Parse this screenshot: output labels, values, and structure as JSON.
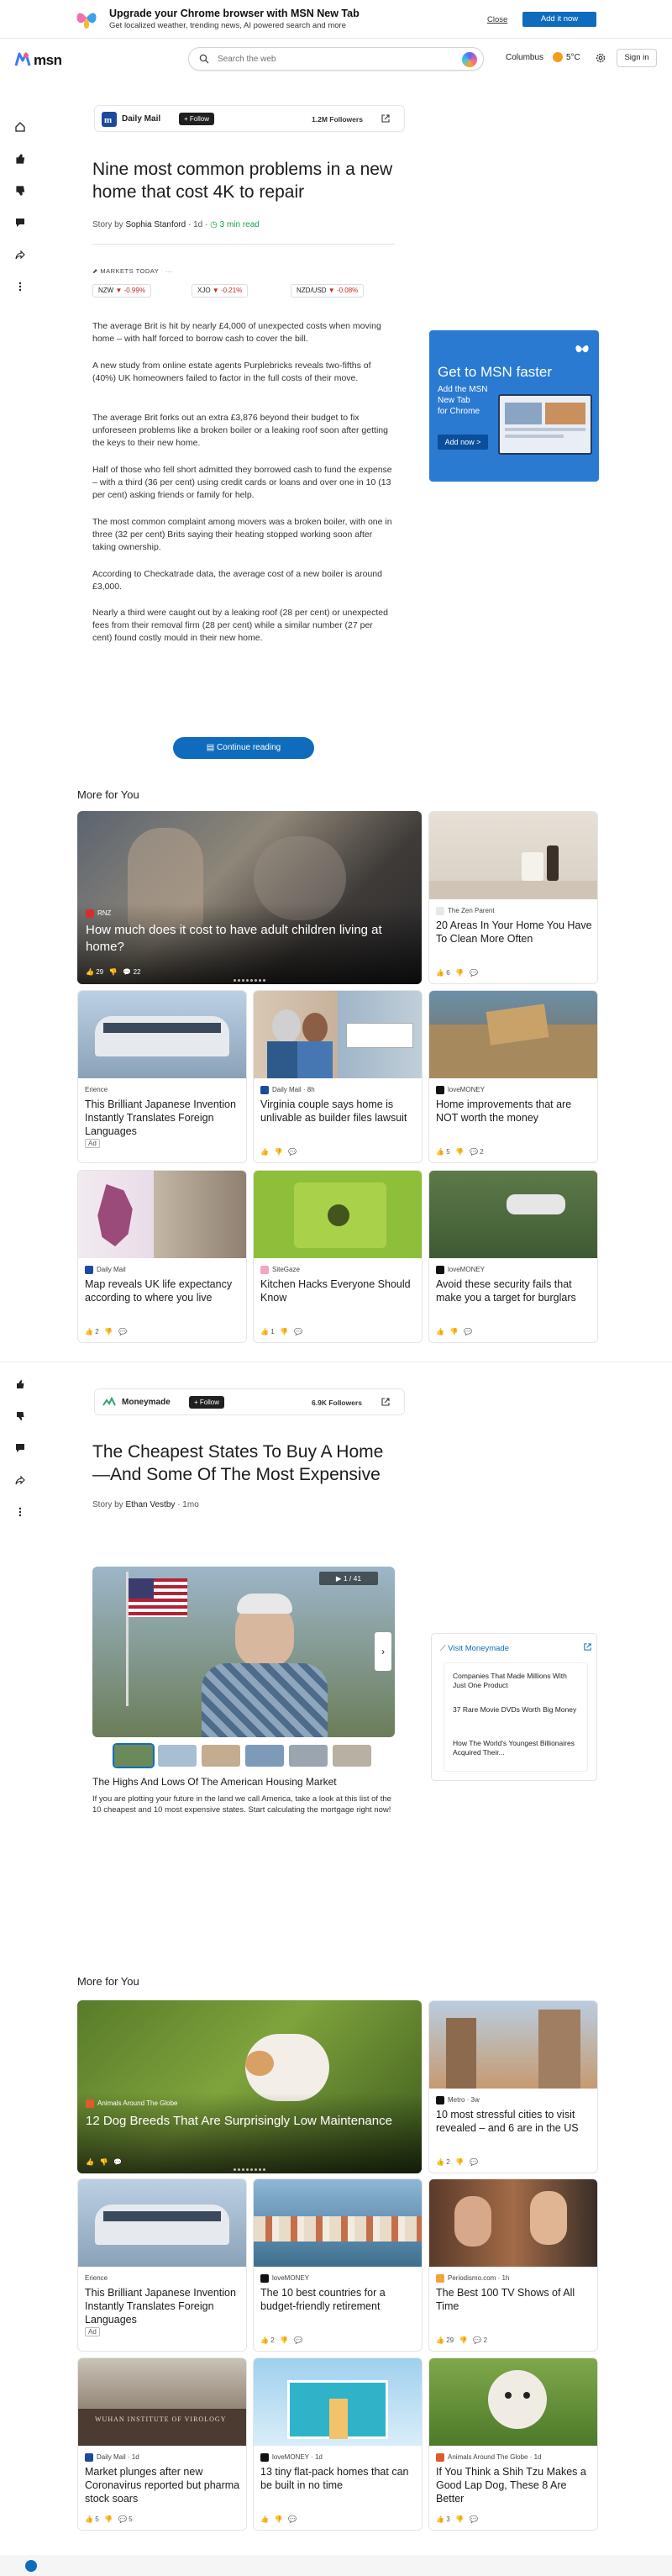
{
  "promo": {
    "title": "Upgrade your Chrome browser with MSN New Tab",
    "subtitle": "Get localized weather, trending news, AI powered search and more",
    "close_label": "Close",
    "add_label": "Add it now"
  },
  "header": {
    "brand": "msn",
    "search_placeholder": "Search the web",
    "location": "Columbus",
    "temperature": "5°C",
    "signin_label": "Sign in"
  },
  "article1": {
    "publisher": "Daily Mail",
    "follow_label": "+ Follow",
    "followers": "1.2M Followers",
    "title": "Nine most common problems in a new home that cost 4K to repair",
    "story_by": "Story by",
    "author": "Sophia Stanford",
    "age": "1d",
    "read_time": "3 min read",
    "markets_label": "MARKETS TODAY",
    "markets": [
      {
        "symbol": "NZW",
        "change": "-0.99%"
      },
      {
        "symbol": "XJO",
        "change": "-0.21%"
      },
      {
        "symbol": "NZD/USD",
        "change": "-0.08%"
      }
    ],
    "paragraphs": [
      "The average Brit is hit by nearly £4,000 of unexpected costs when moving home – with half forced to borrow cash to cover the bill.",
      "A new study from online estate agents Purplebricks reveals two-fifths of (40%) UK homeowners failed to factor in the full costs of their move.",
      "The average Brit forks out an extra £3,876 beyond their budget to fix unforeseen problems like a broken boiler or a leaking roof soon after getting the keys to their new home.",
      "Half of those who fell short admitted they borrowed cash to fund the expense – with a third (36 per cent) using credit cards or loans and over one in 10 (13 per cent) asking friends or family for help.",
      "The most common complaint among movers was a broken boiler, with one in three (32 per cent) Brits saying their heating stopped working soon after taking ownership.",
      "According to Checkatrade data, the average cost of a new boiler is around £3,000.",
      "Nearly a third were caught out by a leaking roof (28 per cent) or unexpected fees from their removal firm (28 per cent) while a similar number (27 per cent) found costly mould in their new home."
    ],
    "continue_label": "Continue reading"
  },
  "ad": {
    "line1": "Get to MSN faster",
    "line2": "Add the MSN",
    "line3": "New Tab",
    "line4": "for Chrome",
    "button": "Add now >"
  },
  "feed1": {
    "title": "More for You",
    "big": {
      "source": "RNZ",
      "title": "How much does it cost to have adult children living at home?",
      "likes": "29",
      "comments": "22"
    },
    "cards": [
      {
        "source": "The Zen Parent",
        "title": "20 Areas In Your Home You Have To Clean More Often",
        "likes": "6",
        "comments": ""
      },
      {
        "source": "Erience",
        "title": "This Brilliant Japanese Invention Instantly Translates Foreign Languages",
        "ad": "Ad",
        "likes": "",
        "comments": ""
      },
      {
        "source": "Daily Mail · 8h",
        "title": "Virginia couple says home is unlivable as builder files lawsuit",
        "likes": "",
        "comments": ""
      },
      {
        "source": "loveMONEY",
        "title": "Home improvements that are NOT worth the money",
        "likes": "5",
        "comments": "2"
      },
      {
        "source": "Daily Mail",
        "title": "Map reveals UK life expectancy according to where you live",
        "likes": "2",
        "comments": ""
      },
      {
        "source": "SiteGaze",
        "title": "Kitchen Hacks Everyone Should Know",
        "likes": "1",
        "comments": ""
      },
      {
        "source": "loveMONEY",
        "title": "Avoid these security fails that make you a target for burglars",
        "likes": "",
        "comments": ""
      }
    ]
  },
  "article2": {
    "publisher": "Moneymade",
    "follow_label": "+ Follow",
    "followers": "6.9K Followers",
    "title": "The Cheapest States To Buy A Home —And Some Of The Most Expensive",
    "story_by": "Story by",
    "author": "Ethan Vestby",
    "age": "1mo",
    "slide_counter": "1 / 41",
    "caption_title": "The Highs And Lows Of The American Housing Market",
    "caption_text": "If you are plotting your future in the land we call America, take a look at this list of the 10 cheapest and 10 most expensive states. Start calculating the mortgage right now!",
    "sidebar_title": "Visit Moneymade",
    "sidebar_links": [
      "Companies That Made Millions With Just One Product",
      "37 Rare Movie DVDs Worth Big Money",
      "How The World's Youngest Billionaires Acquired Their..."
    ]
  },
  "feed2": {
    "title": "More for You",
    "big": {
      "source": "Animals Around The Globe",
      "title": "12 Dog Breeds That Are Surprisingly Low Maintenance"
    },
    "cards": [
      {
        "source": "Metro · 3w",
        "title": "10 most stressful cities to visit revealed – and 6 are in the US",
        "likes": "2",
        "comments": ""
      },
      {
        "source": "Erience",
        "title": "This Brilliant Japanese Invention Instantly Translates Foreign Languages",
        "ad": "Ad",
        "likes": "",
        "comments": ""
      },
      {
        "source": "loveMONEY",
        "title": "The 10 best countries for a budget-friendly retirement",
        "likes": "2",
        "comments": ""
      },
      {
        "source": "Periodismo.com · 1h",
        "title": "The Best 100 TV Shows of All Time",
        "likes": "29",
        "comments": "2"
      },
      {
        "source": "Daily Mail · 1d",
        "title": "Market plunges after new Coronavirus reported but pharma stock soars",
        "likes": "5",
        "comments": "5"
      },
      {
        "source": "loveMONEY · 1d",
        "title": "13 tiny flat-pack homes that can be built in no time",
        "likes": "",
        "comments": ""
      },
      {
        "source": "Animals Around The Globe · 1d",
        "title": "If You Think a Shih Tzu Makes a Good Lap Dog, These 8 Are Better",
        "likes": "3",
        "comments": ""
      }
    ]
  },
  "colors": {
    "accent": "#0f6cbd",
    "negative": "#c42b1c",
    "ad_blue": "#2a7ad1"
  }
}
